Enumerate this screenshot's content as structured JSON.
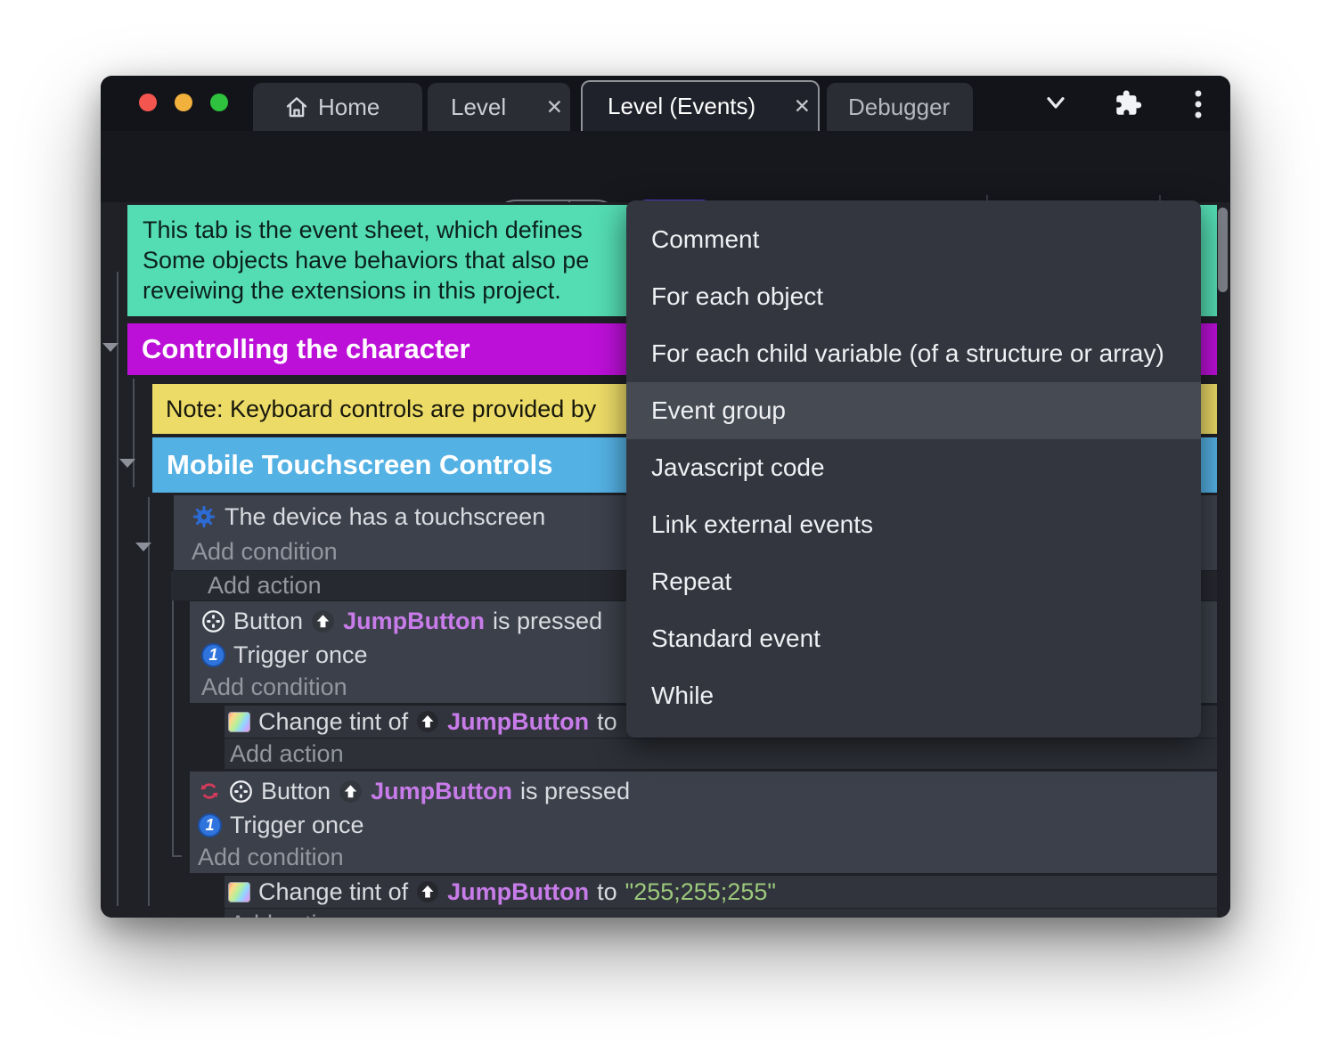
{
  "glyphs": {
    "close": "✕"
  },
  "tabs": [
    {
      "label": "Home"
    },
    {
      "label": "Level"
    },
    {
      "label": "Level (Events)"
    },
    {
      "label": "Debugger"
    }
  ],
  "context_menu": {
    "highlighted": "Event group",
    "items": [
      "Comment",
      "For each object",
      "For each child variable (of a structure or array)",
      "Event group",
      "Javascript code",
      "Link external events",
      "Repeat",
      "Standard event",
      "While"
    ]
  },
  "sheet": {
    "comment_lines": [
      "This tab is the event sheet, which defines",
      "Some objects have behaviors that also pe",
      "reveiwing the extensions in this project."
    ],
    "group1": "Controlling the character",
    "note": "Note: Keyboard controls are provided by",
    "group2": "Mobile Touchscreen Controls",
    "cond_touch": "The device has a touchscreen",
    "add_condition": "Add condition",
    "add_action": "Add action",
    "btn_word": "Button",
    "obj": "JumpButton",
    "is_pressed": "is pressed",
    "trigger_once": "Trigger once",
    "trigger_badge": "1",
    "change_tint": "Change tint of",
    "to_word": "to",
    "tint_value": "\"255;255;255\""
  },
  "colors": {
    "accent_button": "#5a3bd6",
    "group_purple": "#bc10d8",
    "group_blue": "#54b1e4",
    "note_yellow": "#ecdb67",
    "comment_teal": "#54dcb2",
    "object_violet": "#c87ce9",
    "string_green": "#9cc97c",
    "invert_red": "#d63a5c",
    "trigger_blue": "#2f74dc",
    "gear_blue": "#2d6bd4",
    "traffic_red": "#f4554f",
    "traffic_yellow": "#f2b13c",
    "traffic_green": "#2ec23e"
  }
}
